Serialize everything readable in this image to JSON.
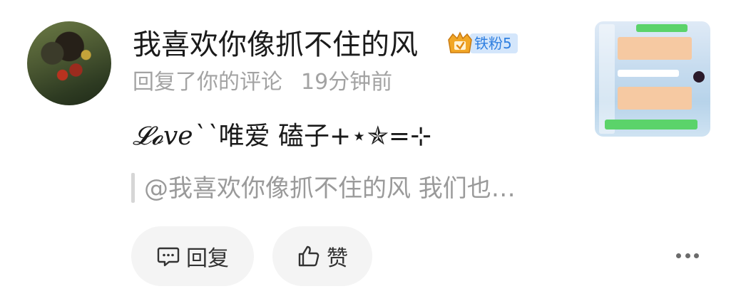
{
  "comment": {
    "username": "我喜欢你像抓不住的风",
    "fan_badge": {
      "label": "铁粉5",
      "icon": "crown-badge-icon"
    },
    "action_text": "回复了你的评论",
    "time_ago": "19分钟前",
    "content_prefix": "𝓛𝓸ve``",
    "content_text": "唯爱 磕子+⋆✯=⊹",
    "quoted_text": "@我喜欢你像抓不住的风 我们也…"
  },
  "actions": {
    "reply_label": "回复",
    "like_label": "赞"
  },
  "icons": {
    "reply": "comment-icon",
    "like": "thumbs-up-icon",
    "more": "more-dots-icon"
  },
  "colors": {
    "badge_bg": "#d4e6fb",
    "badge_text": "#2f7fe0",
    "muted_text": "#a3a3a3",
    "button_bg": "#f4f4f4"
  }
}
